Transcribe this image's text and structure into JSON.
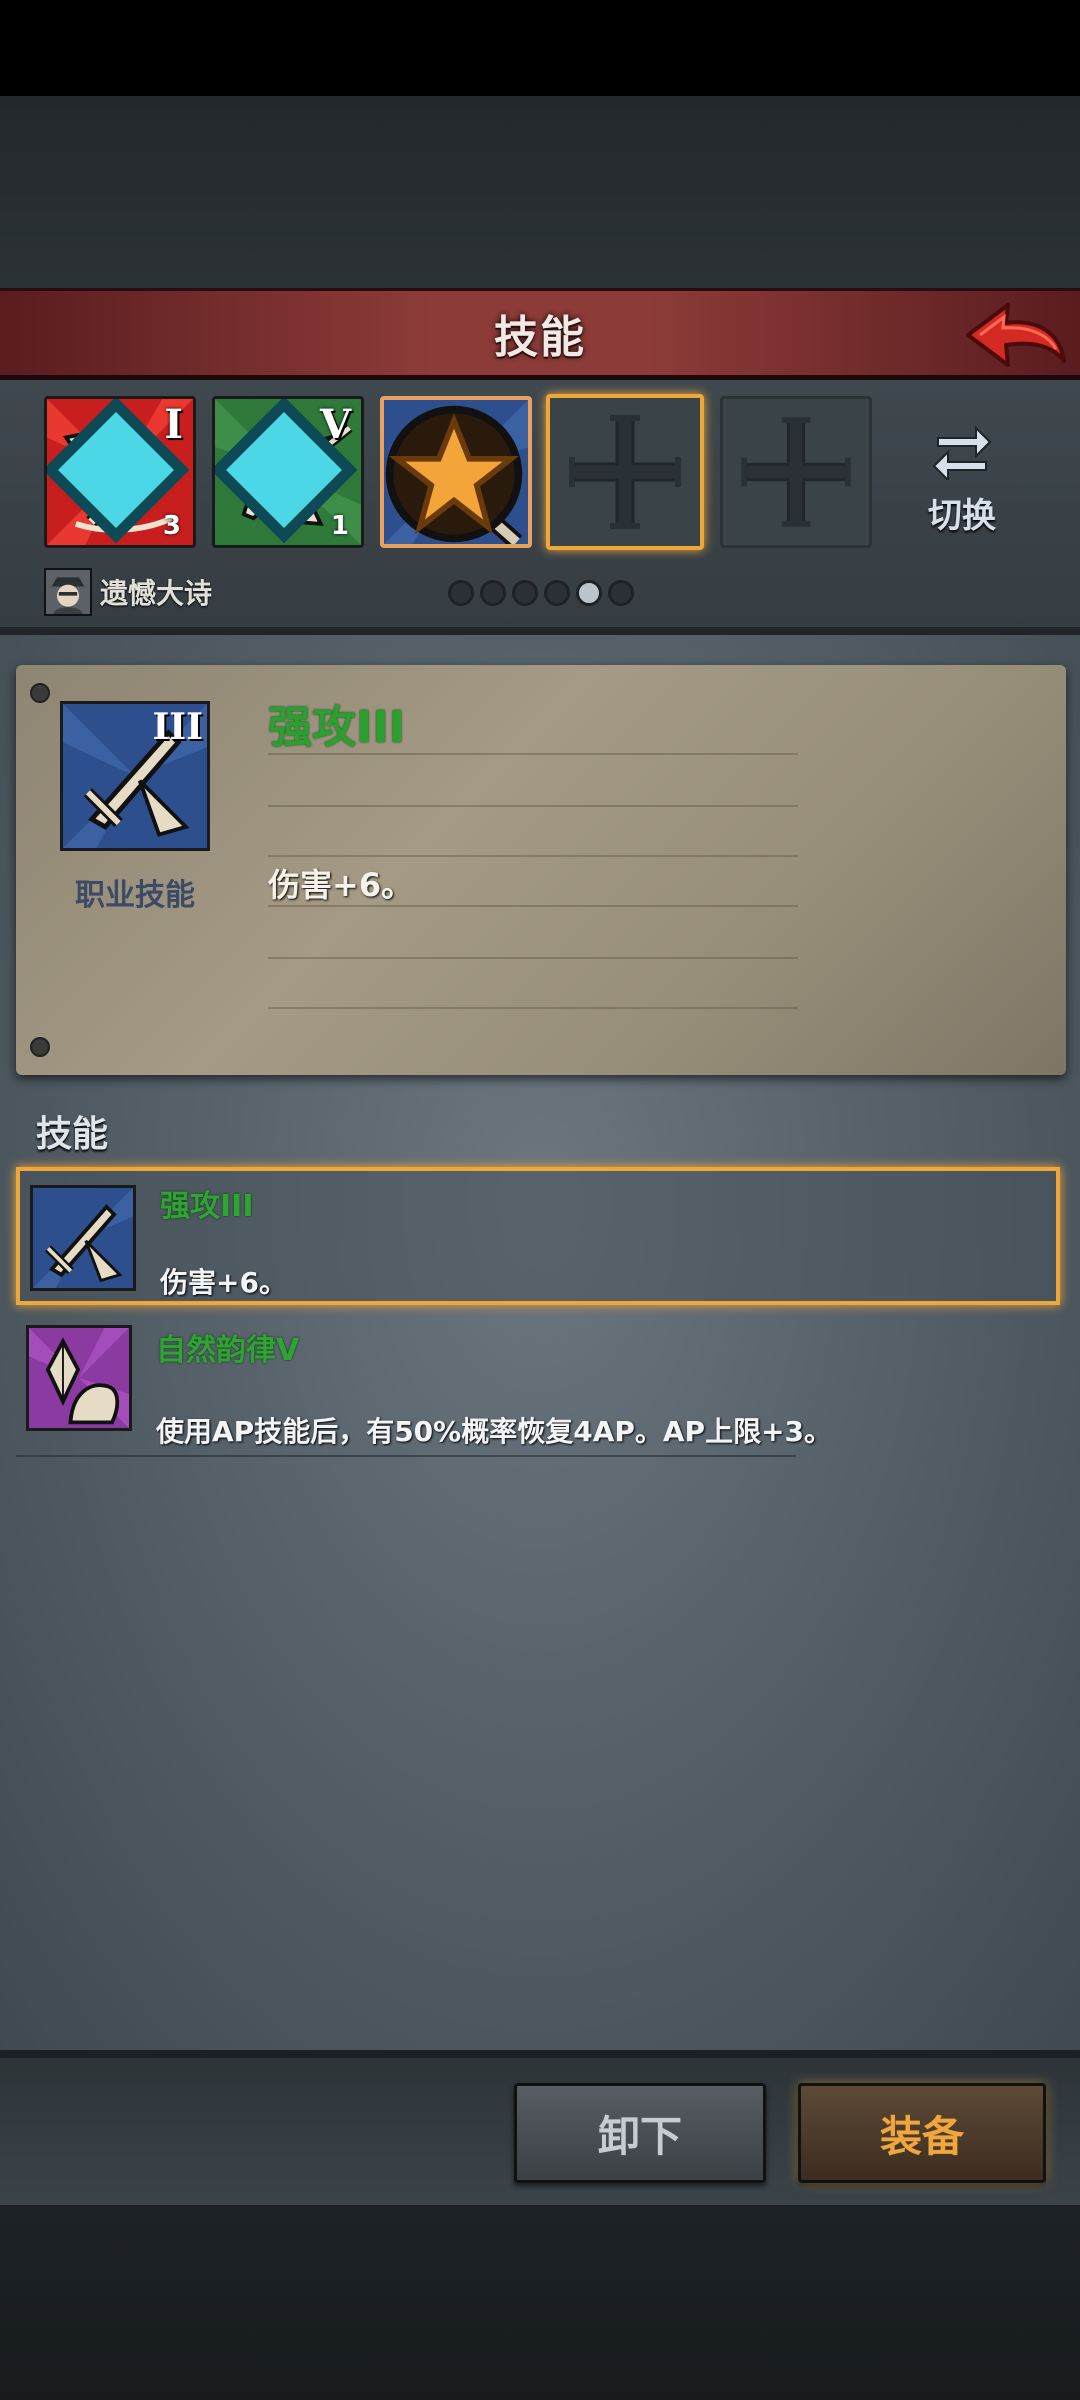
{
  "header": {
    "title": "技能",
    "back_icon": "back-arrow-icon"
  },
  "slots": [
    {
      "id": "slot-1",
      "roman": "I",
      "badge": "3",
      "color": "#c81e1e",
      "icon": "wing-sword-icon"
    },
    {
      "id": "slot-2",
      "roman": "V",
      "badge": "1",
      "color": "#2f7a3a",
      "icon": "feather-sword-icon"
    },
    {
      "id": "slot-3",
      "roman": "",
      "badge": "",
      "color": "#2d4f8e",
      "icon": "sword-fist-icon",
      "starred": true
    },
    {
      "id": "slot-4",
      "empty": true,
      "icon": "cross-icon"
    },
    {
      "id": "slot-5",
      "empty": true,
      "icon": "cross-icon"
    }
  ],
  "switch": {
    "label": "切换",
    "icon": "swap-arrows-icon"
  },
  "player": {
    "name": "遗憾大诗"
  },
  "pager": {
    "total": 6,
    "active": 5
  },
  "detail": {
    "name": "强攻III",
    "roman": "III",
    "type_label": "职业技能",
    "description": "伤害+6。"
  },
  "section": {
    "title": "技能"
  },
  "skills": [
    {
      "name": "强攻III",
      "description": "伤害+6。",
      "selected": true,
      "icon": "sword-icon"
    },
    {
      "name": "自然韵律V",
      "description": "使用AP技能后，有50%概率恢复4AP。AP上限+3。",
      "selected": false,
      "icon": "crystal-hand-icon"
    }
  ],
  "buttons": {
    "unequip": "卸下",
    "equip": "装备"
  }
}
